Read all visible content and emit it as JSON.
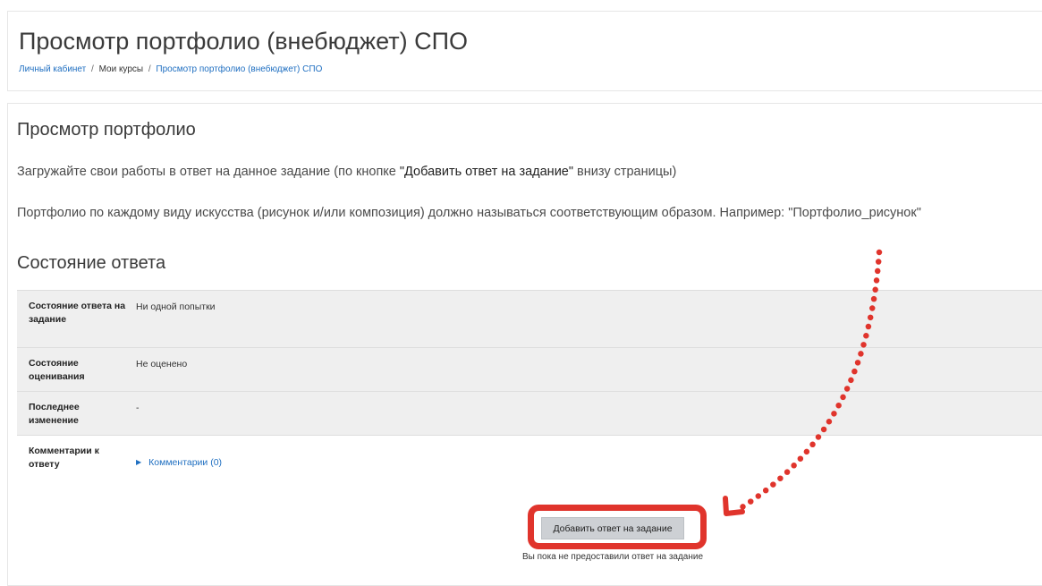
{
  "header": {
    "title": "Просмотр портфолио (внебюджет) СПО",
    "breadcrumb": [
      {
        "label": "Личный кабинет"
      },
      {
        "label": "Мои курсы"
      },
      {
        "label": "Просмотр портфолио (внебюджет) СПО"
      }
    ],
    "separator": "/"
  },
  "assignment": {
    "heading": "Просмотр портфолио",
    "intro_prefix": "Загружайте свои работы в ответ на данное задание (по кнопке ",
    "intro_highlight": "\"Добавить ответ на задание\"",
    "intro_suffix": " внизу страницы)",
    "naming_note": "Портфолио по каждому виду искусства (рисунок и/или композиция) должно называться соответствующим образом. Например: \"Портфолио_рисунок\""
  },
  "submission_status": {
    "heading": "Состояние ответа",
    "rows": [
      {
        "label": "Состояние ответа на задание",
        "value": "Ни одной попытки"
      },
      {
        "label": "Состояние оценивания",
        "value": "Не оценено"
      },
      {
        "label": "Последнее изменение",
        "value": "-"
      },
      {
        "label": "Комментарии к ответу",
        "value": "Комментарии (0)"
      }
    ]
  },
  "actions": {
    "add_submission_label": "Добавить ответ на задание",
    "note": "Вы пока не предоставили ответ на задание"
  },
  "icons": {
    "comments_toggle": "caret-right-icon",
    "annotation": "dotted-curved-arrow-icon"
  },
  "colors": {
    "link": "#1f6fc1",
    "annotation": "#e0342c",
    "table_shade": "#efefef",
    "button_bg": "#cdd0d4"
  }
}
